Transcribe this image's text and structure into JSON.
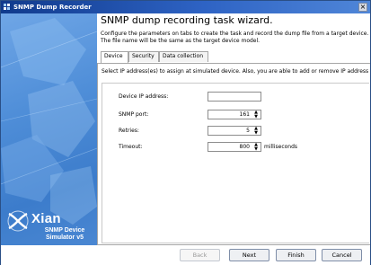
{
  "window": {
    "title": "SNMP Dump Recorder",
    "close_glyph": "×"
  },
  "branding": {
    "logo_name": "Xian",
    "logo_subtitle": "SNMP Device Simulator v5",
    "logo_icon": "xian-logo-icon"
  },
  "wizard": {
    "heading": "SNMP dump recording task wizard.",
    "description": "Configure the parameters on tabs to create the task and record the dump file from a target device. The file name will be the same as the target device model."
  },
  "tabs": [
    {
      "label": "Device",
      "active": true
    },
    {
      "label": "Security",
      "active": false
    },
    {
      "label": "Data collection",
      "active": false
    }
  ],
  "device_tab": {
    "intro": "Select IP address(es) to assign at simulated device. Also, you are able to add or remove IP address",
    "fields": {
      "ip_label": "Device IP address:",
      "ip_value": "",
      "port_label": "SNMP port:",
      "port_value": "161",
      "retries_label": "Retries:",
      "retries_value": "5",
      "timeout_label": "Timeout:",
      "timeout_value": "800",
      "timeout_unit": "milliseconds"
    },
    "spin_up": "▲",
    "spin_down": "▼"
  },
  "buttons": {
    "back": "Back",
    "next": "Next",
    "finish": "Finish",
    "cancel": "Cancel"
  },
  "colors": {
    "titlebar": "#103a8c",
    "sidebar": "#4f8ed8"
  }
}
